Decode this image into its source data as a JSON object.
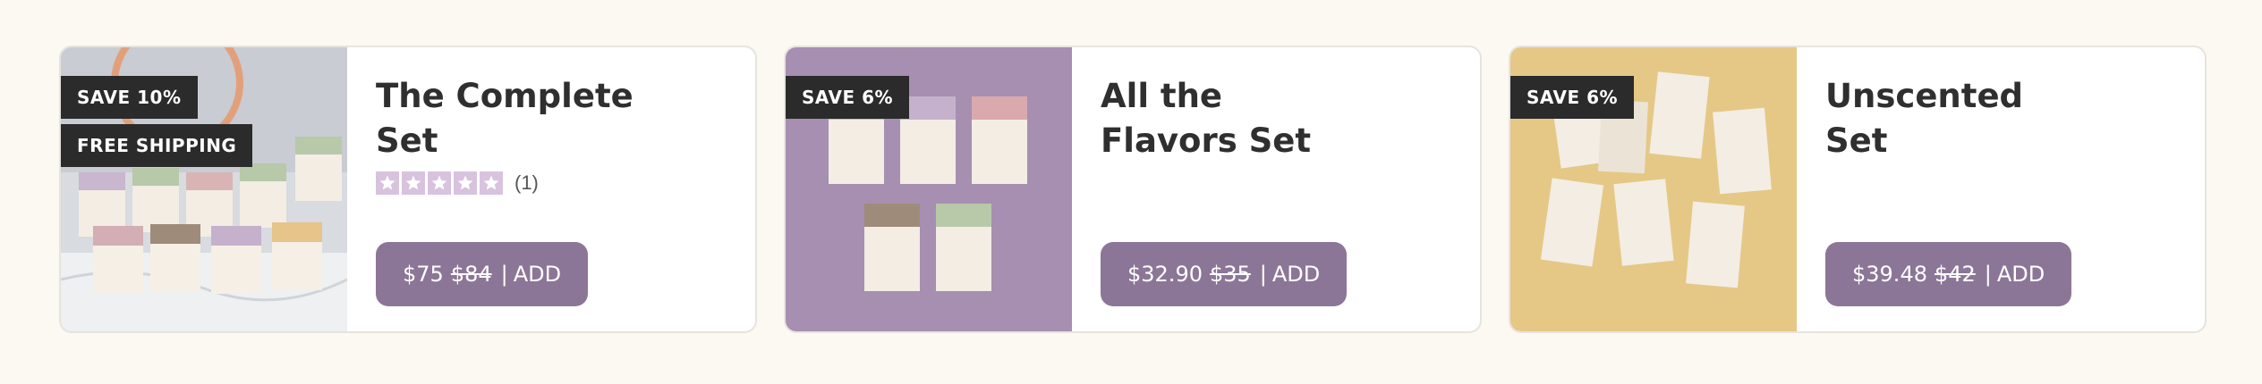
{
  "products": [
    {
      "title": "The Complete\nSet",
      "badges": [
        "SAVE 10%",
        "FREE SHIPPING"
      ],
      "rating": {
        "stars": 5,
        "filled": 0,
        "count": "(1)"
      },
      "price": "$75",
      "compare_price": "$84",
      "separator": "|",
      "add_label": "ADD",
      "image_bg": "#d8dbe0"
    },
    {
      "title": "All the\nFlavors Set",
      "badges": [
        "SAVE 6%"
      ],
      "price": "$32.90",
      "compare_price": "$35",
      "separator": "|",
      "add_label": "ADD",
      "image_bg": "#a68fb0"
    },
    {
      "title": "Unscented\nSet",
      "badges": [
        "SAVE 6%"
      ],
      "price": "$39.48",
      "compare_price": "$42",
      "separator": "|",
      "add_label": "ADD",
      "image_bg": "#e5c885"
    }
  ],
  "theme": {
    "page_bg": "#fcf8f2",
    "button_bg": "#8c7697",
    "badge_bg": "#2b2b2b",
    "star_color": "#d8c3de"
  },
  "icons": {
    "rating": "star-icon"
  }
}
